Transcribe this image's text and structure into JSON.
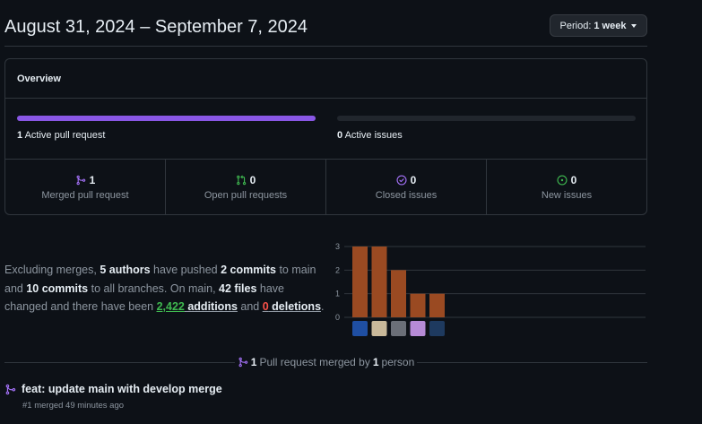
{
  "header": {
    "title": "August 31, 2024 – September 7, 2024",
    "period_prefix": "Period:",
    "period_value": "1 week"
  },
  "overview": {
    "heading": "Overview",
    "pull_requests": {
      "count": "1",
      "label": "Active pull request",
      "fill": 1.0
    },
    "issues": {
      "count": "0",
      "label": "Active issues",
      "fill": 0.0
    },
    "stats": [
      {
        "count": "1",
        "label": "Merged pull request",
        "icon": "merge-icon",
        "color": "#a371f7"
      },
      {
        "count": "0",
        "label": "Open pull requests",
        "icon": "pull-request-icon",
        "color": "#3fb950"
      },
      {
        "count": "0",
        "label": "Closed issues",
        "icon": "issue-closed-icon",
        "color": "#a371f7"
      },
      {
        "count": "0",
        "label": "New issues",
        "icon": "issue-opened-icon",
        "color": "#3fb950"
      }
    ]
  },
  "summary": {
    "t1": "Excluding merges, ",
    "authors": "5 authors",
    "t2": " have pushed ",
    "commits_main": "2 commits",
    "t3": " to main and ",
    "commits_all": "10 commits",
    "t4": " to all branches. On main, ",
    "files": "42 files",
    "t5": " have changed and there have been ",
    "additions_num": "2,422",
    "additions_word": " additions",
    "t6": " and ",
    "deletions_num": "0",
    "deletions_word": " deletions",
    "t7": "."
  },
  "chart_data": {
    "type": "bar",
    "categories": [
      "author-1",
      "author-2",
      "author-3",
      "author-4",
      "author-5"
    ],
    "values": [
      3,
      3,
      2,
      1,
      1
    ],
    "yticks": [
      "0",
      "1",
      "2",
      "3"
    ],
    "ylim": [
      0,
      3
    ],
    "bar_color": "#9a4a22",
    "avatar_colors": [
      "#1f4fa3",
      "#c9b99a",
      "#6b6f78",
      "#b68bd6",
      "#1e3a5f"
    ]
  },
  "merged_section": {
    "count": "1",
    "t1": " Pull request merged by ",
    "persons": "1",
    "t2": " person"
  },
  "pull_request": {
    "title": "feat: update main with develop merge",
    "meta": "#1 merged 49 minutes ago"
  },
  "colors": {
    "accent": "#8957e5",
    "green": "#3fb950",
    "red": "#f85149"
  }
}
